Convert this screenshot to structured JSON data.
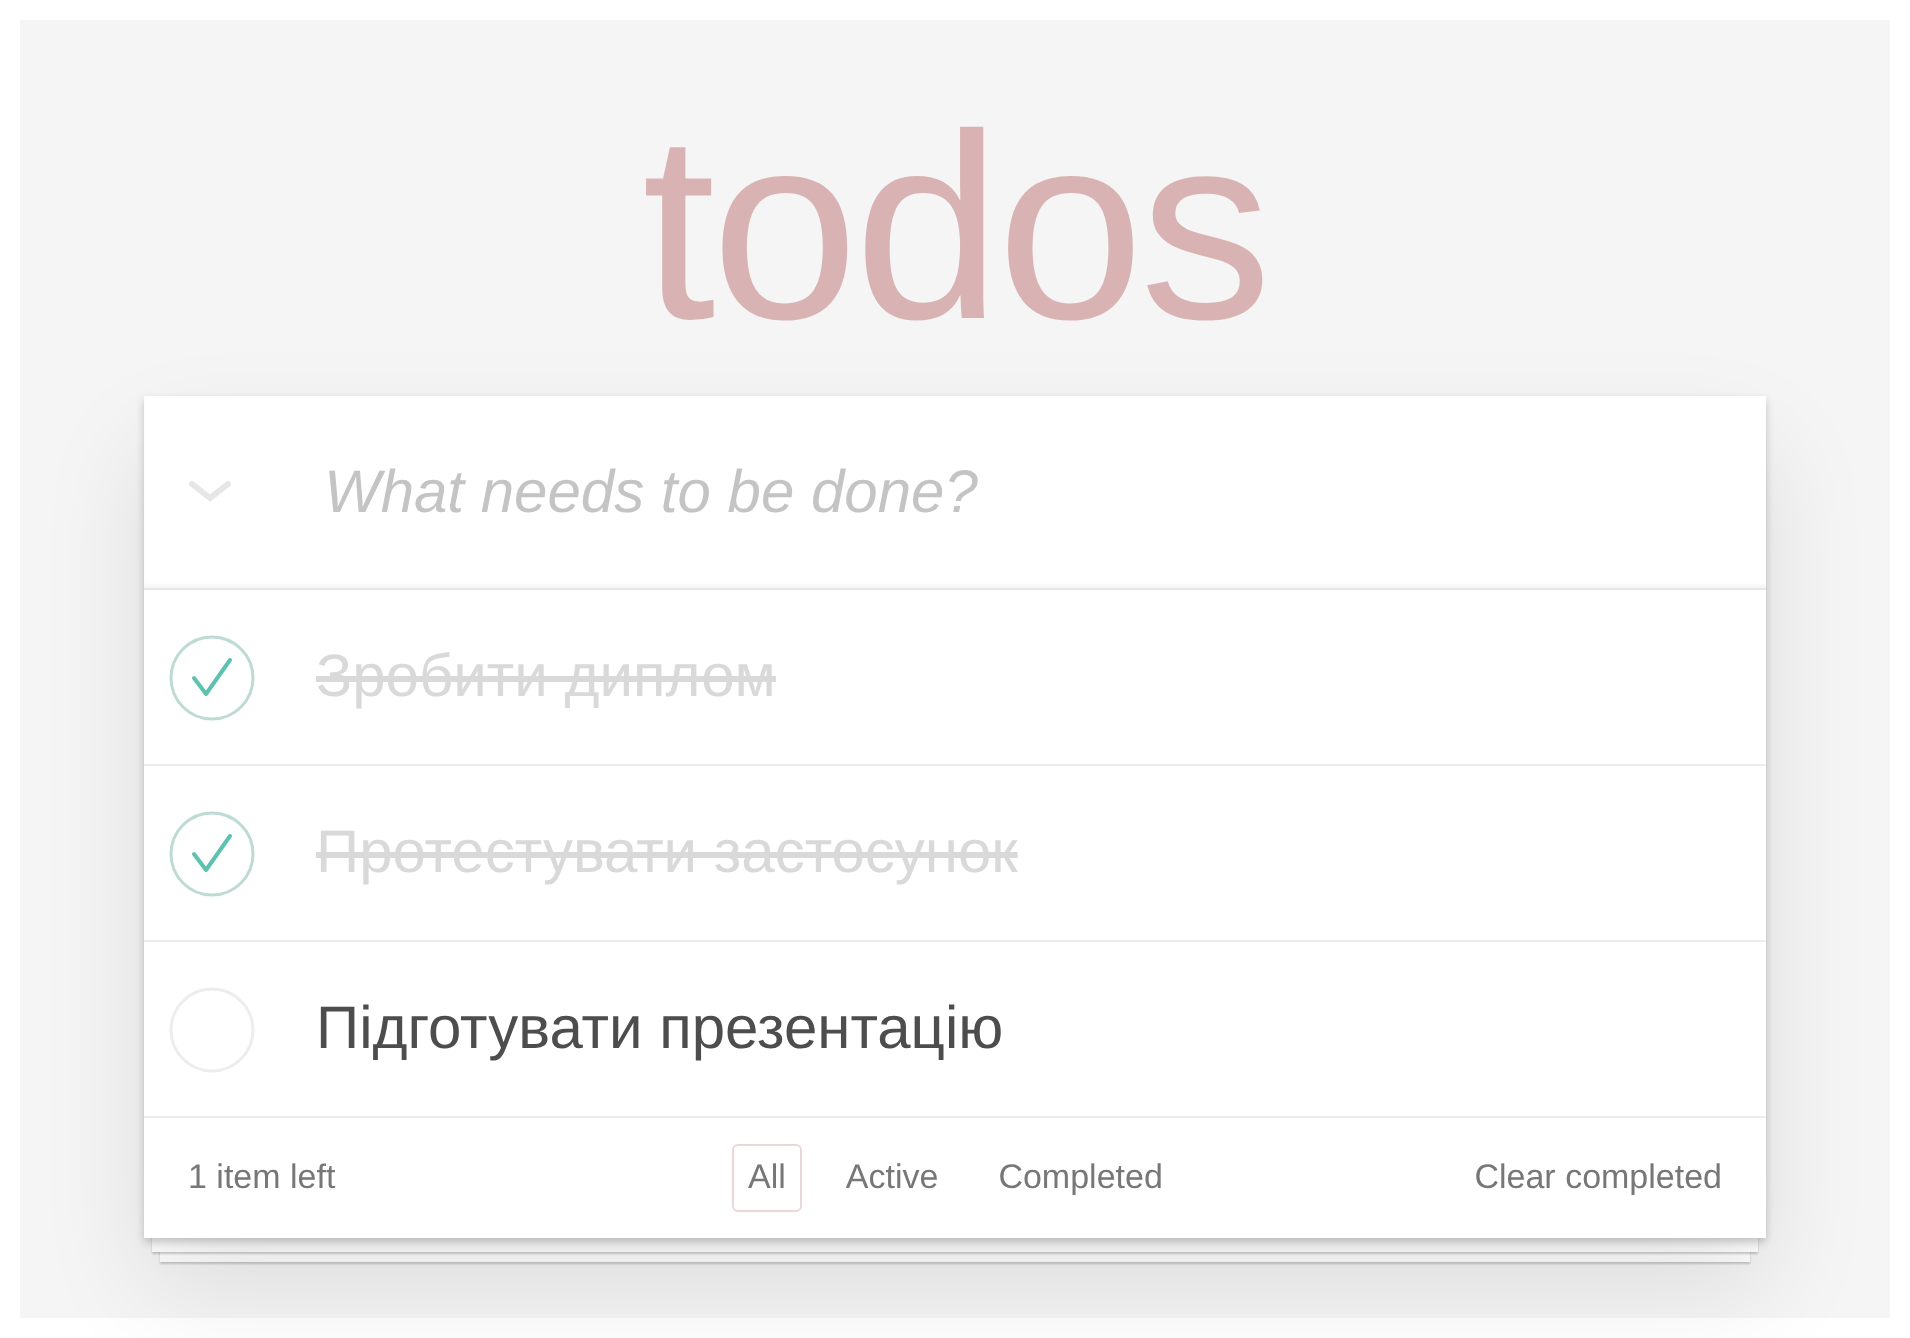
{
  "app": {
    "title": "todos"
  },
  "toggle_all": {
    "checked": false
  },
  "new_todo": {
    "placeholder": "What needs to be done?"
  },
  "todos": [
    {
      "title": "Зробити диплом",
      "completed": true
    },
    {
      "title": "Протестувати застосунок",
      "completed": true
    },
    {
      "title": "Підготувати презентацію",
      "completed": false
    }
  ],
  "footer": {
    "count": "1 item left",
    "filters": [
      {
        "label": "All",
        "selected": true
      },
      {
        "label": "Active",
        "selected": false
      },
      {
        "label": "Completed",
        "selected": false
      }
    ],
    "clear": "Clear completed"
  }
}
